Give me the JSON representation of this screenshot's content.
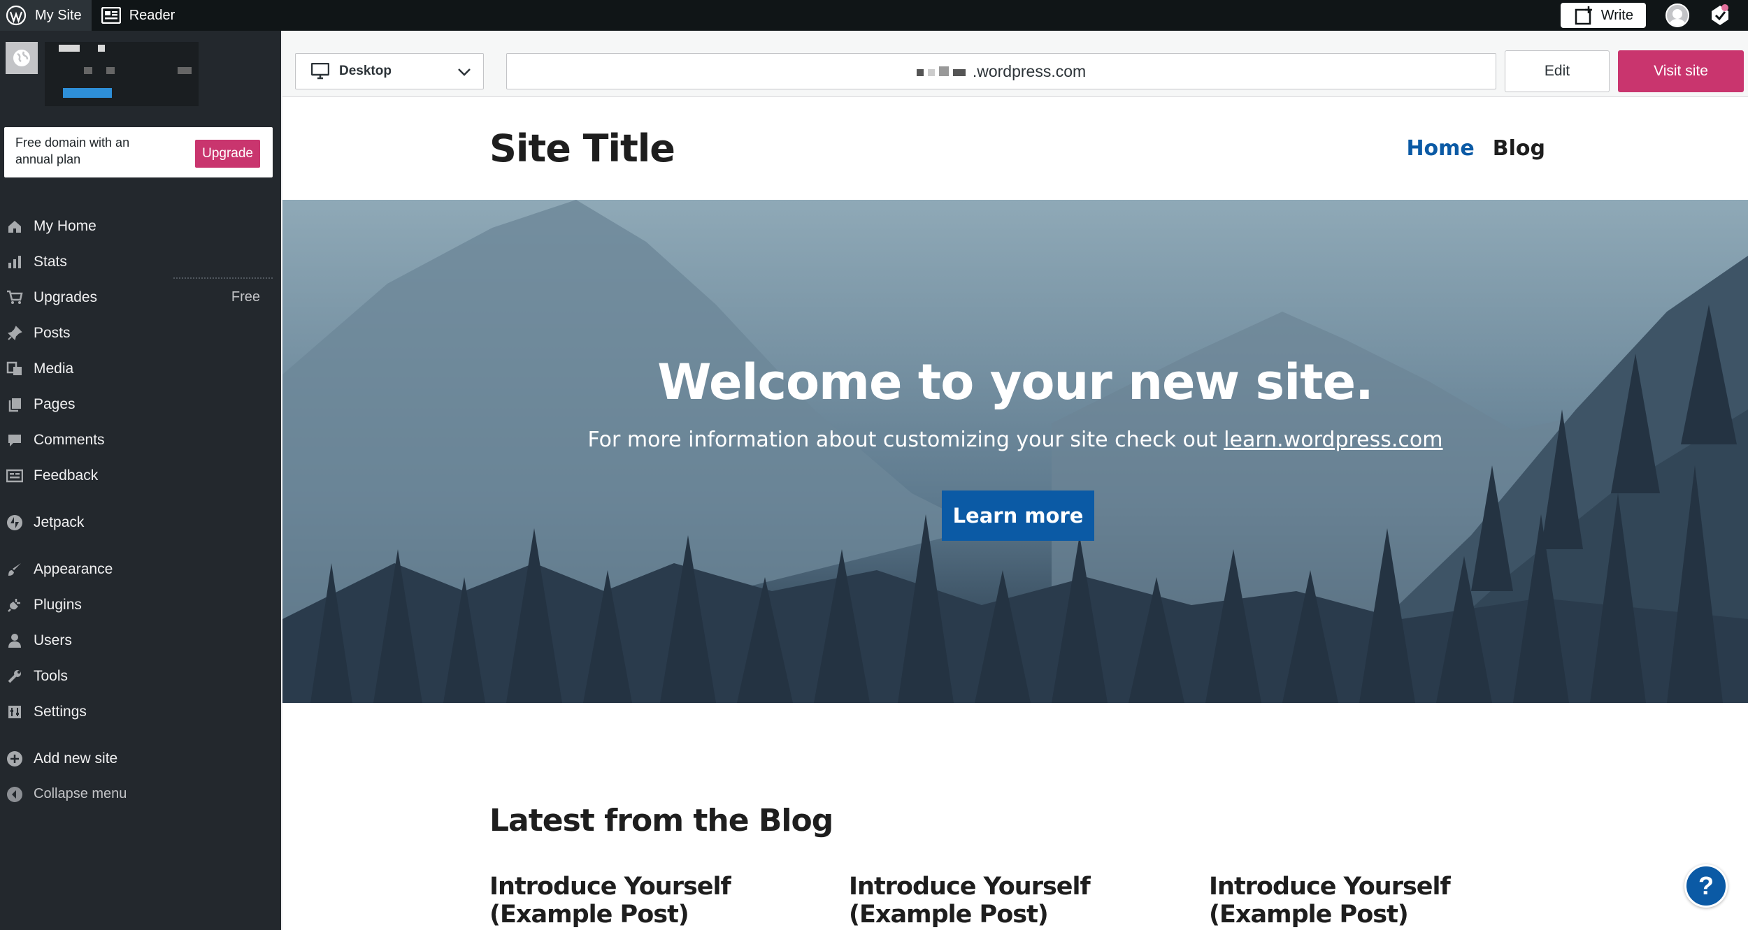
{
  "topbar": {
    "my_site": "My Site",
    "reader": "Reader",
    "write": "Write"
  },
  "sidebar": {
    "domain_promo": "Free domain with an annual plan",
    "upgrade": "Upgrade",
    "items": [
      {
        "label": "My Home",
        "icon": "home-icon"
      },
      {
        "label": "Stats",
        "icon": "stats-icon"
      },
      {
        "label": "Upgrades",
        "icon": "cart-icon",
        "badge": "Free"
      },
      {
        "label": "Posts",
        "icon": "pin-icon"
      },
      {
        "label": "Media",
        "icon": "media-icon"
      },
      {
        "label": "Pages",
        "icon": "pages-icon"
      },
      {
        "label": "Comments",
        "icon": "comment-icon"
      },
      {
        "label": "Feedback",
        "icon": "feedback-icon"
      },
      {
        "label": "Jetpack",
        "icon": "jetpack-icon"
      },
      {
        "label": "Appearance",
        "icon": "brush-icon"
      },
      {
        "label": "Plugins",
        "icon": "plug-icon"
      },
      {
        "label": "Users",
        "icon": "user-icon"
      },
      {
        "label": "Tools",
        "icon": "wrench-icon"
      },
      {
        "label": "Settings",
        "icon": "settings-icon"
      },
      {
        "label": "Add new site",
        "icon": "plus-circle-icon"
      },
      {
        "label": "Collapse menu",
        "icon": "collapse-icon"
      }
    ]
  },
  "preview_toolbar": {
    "device": "Desktop",
    "url_suffix": ".wordpress.com",
    "edit": "Edit",
    "visit_site": "Visit site"
  },
  "site": {
    "title": "Site Title",
    "nav": [
      "Home",
      "Blog"
    ],
    "hero_title": "Welcome to your new site.",
    "hero_sub": "For more information about customizing your site check out",
    "hero_link": "learn.wordpress.com",
    "hero_button": "Learn more",
    "blog_heading": "Latest from the Blog",
    "posts": [
      {
        "line1": "Introduce Yourself",
        "line2": "(Example Post)"
      },
      {
        "line1": "Introduce Yourself",
        "line2": "(Example Post)"
      },
      {
        "line1": "Introduce Yourself",
        "line2": "(Example Post)"
      }
    ]
  },
  "help": "?",
  "colors": {
    "accent_pink": "#c9356e",
    "link_blue": "#0b5aa5",
    "sidebar_bg": "#23282d"
  }
}
